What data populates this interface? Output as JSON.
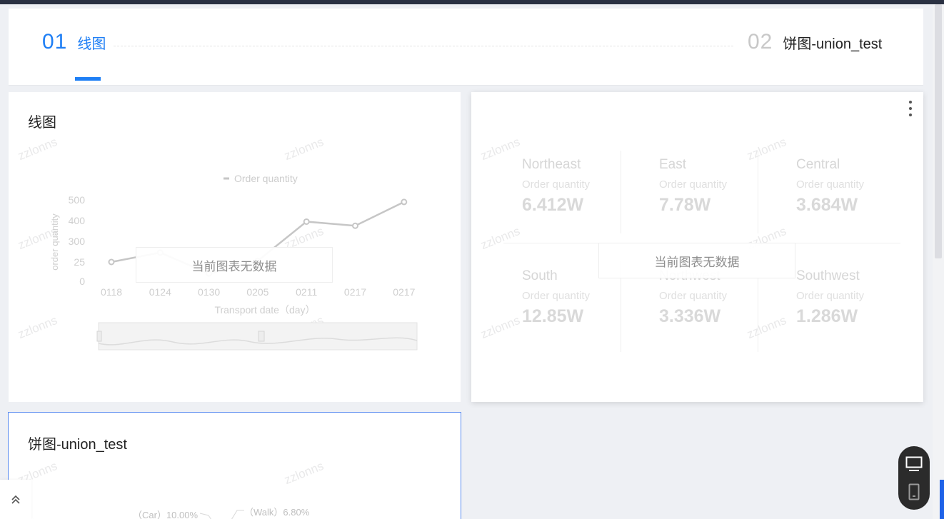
{
  "tabs": [
    {
      "num": "01",
      "label": "线图"
    },
    {
      "num": "02",
      "label": "饼图-union_test"
    }
  ],
  "watermark": "zzlonns",
  "line_card": {
    "title": "线图",
    "no_data": "当前图表无数据"
  },
  "stats_card": {
    "no_data": "当前图表无数据",
    "cells": [
      {
        "region": "Northeast",
        "label": "Order quantity",
        "value": "6.412W"
      },
      {
        "region": "East",
        "label": "Order quantity",
        "value": "7.78W"
      },
      {
        "region": "Central",
        "label": "Order quantity",
        "value": "3.684W"
      },
      {
        "region": "South",
        "label": "Order quantity",
        "value": "12.85W"
      },
      {
        "region": "Northwest",
        "label": "Order quantity",
        "value": "3.336W"
      },
      {
        "region": "Southwest",
        "label": "Order quantity",
        "value": "1.286W"
      }
    ]
  },
  "pie_card": {
    "title": "饼图-union_test",
    "labels": [
      "（Car）10.00%",
      "（Walk）6.80%"
    ]
  },
  "device_switch": {
    "desktop_icon": "monitor-icon",
    "mobile_icon": "phone-icon"
  },
  "back_top_icon": "double-chevron-up-icon",
  "chart_data": {
    "type": "line",
    "legend": [
      "Order quantity"
    ],
    "legend_position": "top-center",
    "xlabel": "Transport date（day）",
    "ylabel": "order quantity",
    "categories": [
      "0118",
      "0124",
      "0130",
      "0205",
      "0211",
      "0217",
      "0217"
    ],
    "y_ticks": [
      "0",
      "25",
      "300",
      "400",
      "500"
    ],
    "series": [
      {
        "name": "Order quantity",
        "values": [
          25,
          150,
          10,
          40,
          395,
          375,
          490
        ]
      }
    ],
    "grid": false,
    "data_zoom_slider": true,
    "colors": {
      "line": "#c6c6c6",
      "axis_text": "#cfcfcf",
      "legend_text": "#cdcdcd"
    }
  }
}
